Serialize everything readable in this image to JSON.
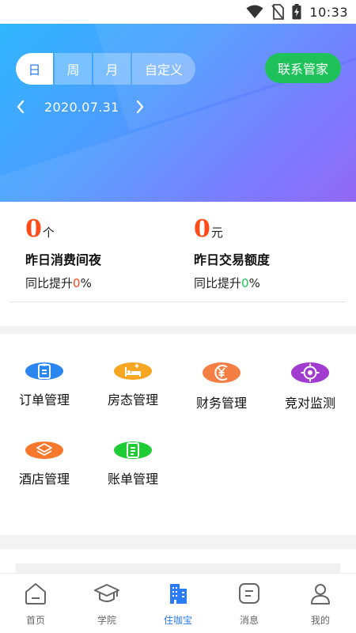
{
  "status_bar": {
    "time": "10:33",
    "icons": [
      "wifi-icon",
      "no-sim-icon",
      "battery-charging-icon"
    ]
  },
  "header": {
    "tabs": [
      {
        "label": "日",
        "active": true
      },
      {
        "label": "周",
        "active": false
      },
      {
        "label": "月",
        "active": false
      },
      {
        "label": "自定义",
        "active": false
      }
    ],
    "contact_button": "联系管家",
    "date": "2020.07.31",
    "prev_icon": "chevron-left-icon",
    "next_icon": "chevron-right-icon"
  },
  "stats": [
    {
      "value": "0",
      "unit": "个",
      "title": "昨日消费间夜",
      "compare_prefix": "同比提升",
      "compare_value": "0",
      "compare_suffix": "%",
      "compare_color": "#ff4a1a"
    },
    {
      "value": "0",
      "unit": "元",
      "title": "昨日交易额度",
      "compare_prefix": "同比提升",
      "compare_value": "0",
      "compare_suffix": "%",
      "compare_color": "#1fc25a"
    }
  ],
  "grid": [
    {
      "label": "订单管理",
      "icon": "order-clipboard-icon",
      "color": "#2b86f0"
    },
    {
      "label": "房态管理",
      "icon": "bed-icon",
      "color": "#f6a623"
    },
    {
      "label": "财务管理",
      "icon": "yen-icon",
      "color": "#f37f45"
    },
    {
      "label": "竞对监测",
      "icon": "target-icon",
      "color": "#a23bd0"
    },
    {
      "label": "酒店管理",
      "icon": "layers-icon",
      "color": "#f5782c"
    },
    {
      "label": "账单管理",
      "icon": "bill-icon",
      "color": "#1fcc36"
    }
  ],
  "bottom_nav": [
    {
      "label": "首页",
      "icon": "home-icon",
      "active": false
    },
    {
      "label": "学院",
      "icon": "graduation-cap-icon",
      "active": false
    },
    {
      "label": "住咖宝",
      "icon": "buildings-icon",
      "active": true
    },
    {
      "label": "消息",
      "icon": "message-icon",
      "active": false
    },
    {
      "label": "我的",
      "icon": "user-icon",
      "active": false
    }
  ],
  "colors": {
    "accent": "#2b7cf6",
    "success": "#1fc25a",
    "highlight": "#ff4a1a"
  }
}
